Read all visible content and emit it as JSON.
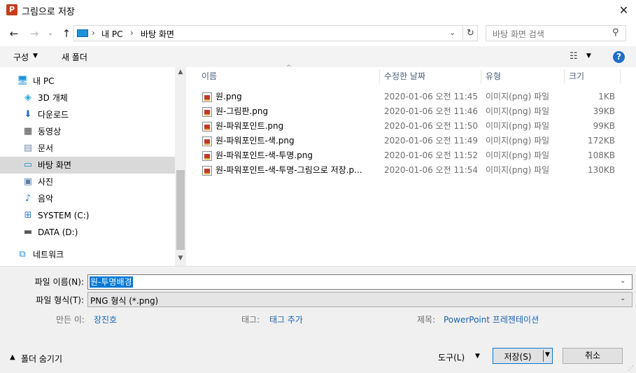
{
  "window": {
    "title": "그림으로 저장",
    "app_icon_letter": "P",
    "close_glyph": "✕"
  },
  "nav_buttons": {
    "back": "←",
    "forward": "→",
    "recent": "⌄",
    "up": "↑"
  },
  "address": {
    "sep": "›",
    "crumbs": [
      "내 PC",
      "바탕 화면"
    ],
    "dropdown": "⌄",
    "refresh": "↻"
  },
  "search": {
    "placeholder": "바탕 화면 검색",
    "icon": "⚲"
  },
  "toolbar": {
    "organize_label": "구성",
    "organize_arrow": "▼",
    "new_folder_label": "새 폴더",
    "view_icon": "☷",
    "view_arrow": "▼",
    "help_label": "?"
  },
  "sidebar": {
    "items": [
      {
        "label": "내 PC",
        "icon": "pc-icon",
        "glyph": "🖥"
      },
      {
        "label": "3D 개체",
        "icon": "3d-objects-icon",
        "glyph": "◈"
      },
      {
        "label": "다운로드",
        "icon": "download-icon",
        "glyph": "⬇"
      },
      {
        "label": "동영상",
        "icon": "video-icon",
        "glyph": "▦"
      },
      {
        "label": "문서",
        "icon": "document-icon",
        "glyph": "▤"
      },
      {
        "label": "바탕 화면",
        "icon": "desktop-icon",
        "glyph": "▭"
      },
      {
        "label": "사진",
        "icon": "pictures-icon",
        "glyph": "▣"
      },
      {
        "label": "음악",
        "icon": "music-icon",
        "glyph": "♪"
      },
      {
        "label": "SYSTEM (C:)",
        "icon": "drive-c-icon",
        "glyph": "⊞"
      },
      {
        "label": "DATA (D:)",
        "icon": "drive-d-icon",
        "glyph": "▬"
      },
      {
        "label": "네트워크",
        "icon": "network-icon",
        "glyph": "⧉"
      }
    ],
    "scroll_up": "▲",
    "scroll_down": "▼"
  },
  "file_list": {
    "columns": [
      "이름",
      "수정한 날짜",
      "유형",
      "크기"
    ],
    "sort_indicator": "^",
    "rows": [
      {
        "name": "원.png",
        "date": "2020-01-06 오전 11:45",
        "type": "이미지(png) 파일",
        "size": "1KB"
      },
      {
        "name": "원-그림판.png",
        "date": "2020-01-06 오전 11:46",
        "type": "이미지(png) 파일",
        "size": "39KB"
      },
      {
        "name": "원-파워포인트.png",
        "date": "2020-01-06 오전 11:50",
        "type": "이미지(png) 파일",
        "size": "99KB"
      },
      {
        "name": "원-파워포인트-색.png",
        "date": "2020-01-06 오전 11:49",
        "type": "이미지(png) 파일",
        "size": "172KB"
      },
      {
        "name": "원-파워포인트-색-투명.png",
        "date": "2020-01-06 오전 11:52",
        "type": "이미지(png) 파일",
        "size": "108KB"
      },
      {
        "name": "원-파워포인트-색-투명-그림으로 저장.p...",
        "date": "2020-01-06 오전 11:54",
        "type": "이미지(png) 파일",
        "size": "130KB"
      }
    ]
  },
  "form": {
    "filename_label": "파일 이름(N):",
    "filename_value": "원-투명배경",
    "filetype_label": "파일 형식(T):",
    "filetype_value": "PNG 형식 (*.png)",
    "dropdown_glyph": "⌄",
    "author_label": "만든 이:",
    "author_value": "장진호",
    "tags_label": "태그:",
    "tags_value": "태그 추가",
    "title_label": "제목:",
    "title_value": "PowerPoint 프레젠테이션",
    "hide_folders_label": "폴더 숨기기",
    "hide_folders_arrow": "▲",
    "tools_label": "도구(L)",
    "tools_arrow": "▼",
    "save_label": "저장(S)",
    "save_arrow": "▼",
    "cancel_label": "취소",
    "grip": "⋰"
  }
}
